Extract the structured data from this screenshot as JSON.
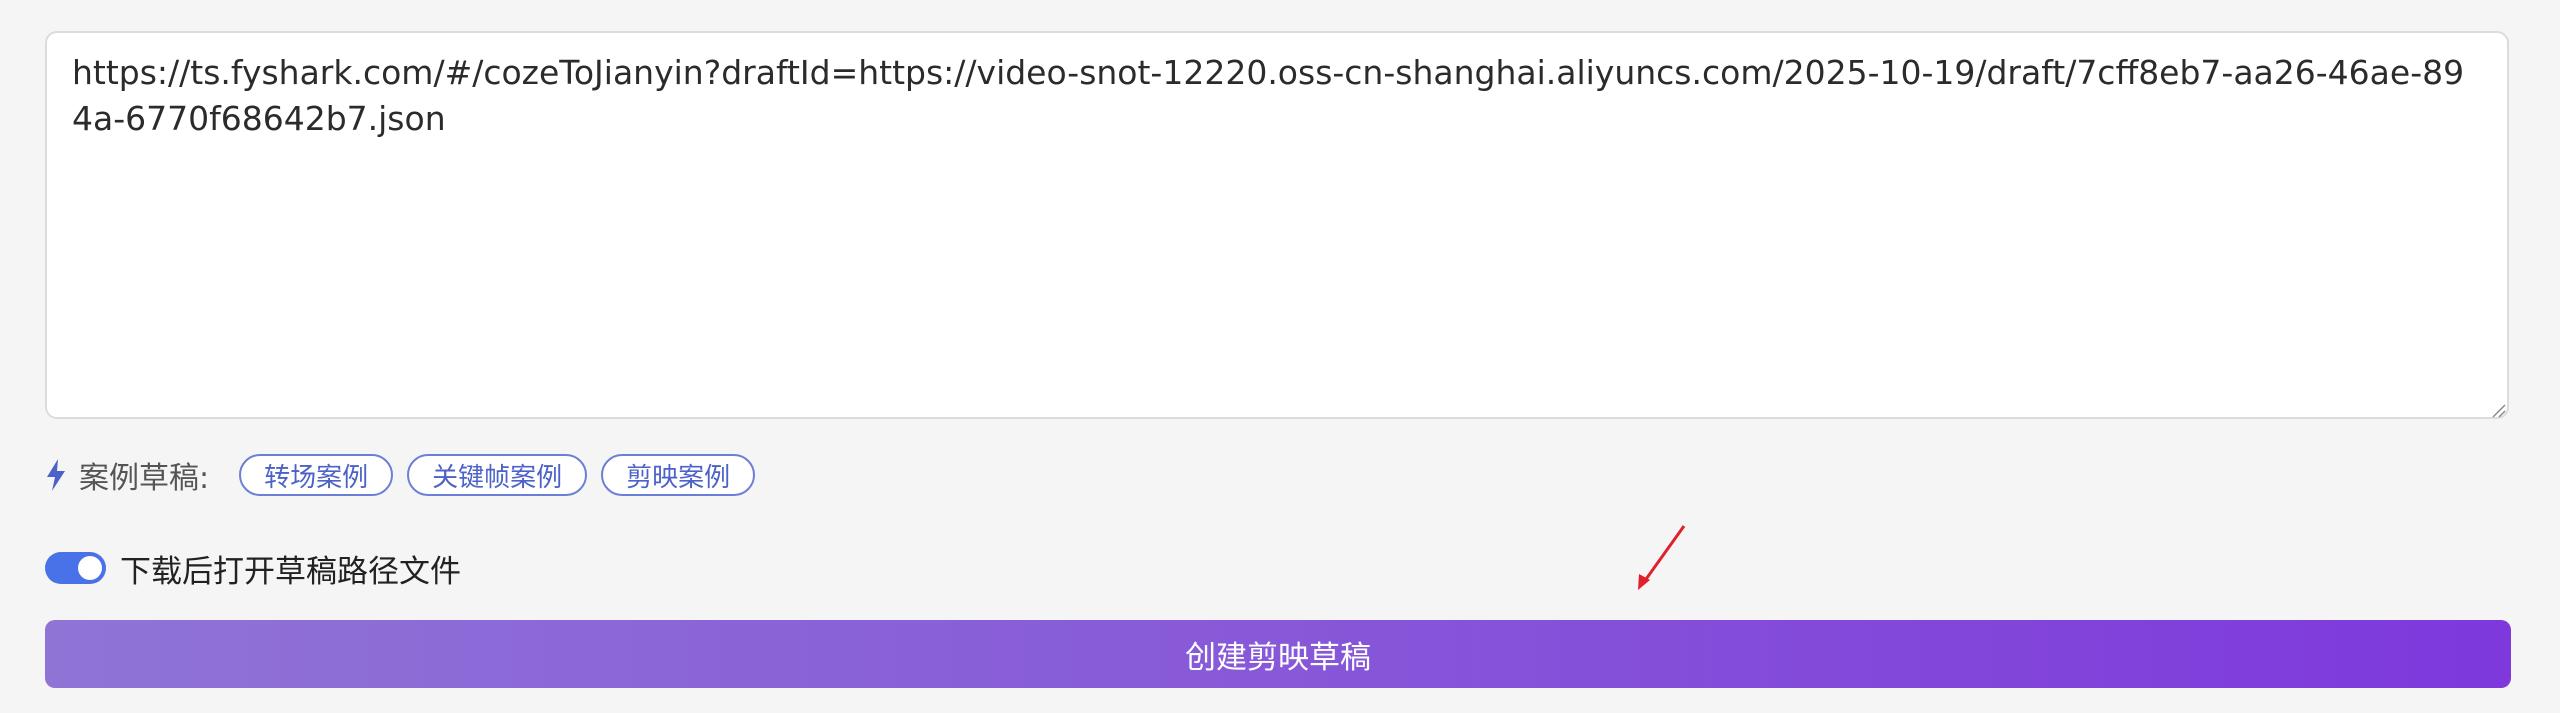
{
  "url_input": {
    "value": "https://ts.fyshark.com/#/cozeToJianyin?draftId=https://video-snot-12220.oss-cn-shanghai.aliyuncs.com/2025-10-19/draft/7cff8eb7-aa26-46ae-894a-6770f68642b7.json"
  },
  "examples": {
    "icon": "bolt-icon",
    "label": "案例草稿:",
    "chips": [
      {
        "label": "转场案例"
      },
      {
        "label": "关键帧案例"
      },
      {
        "label": "剪映案例"
      }
    ]
  },
  "toggle": {
    "checked": true,
    "label": "下载后打开草稿路径文件"
  },
  "annotation": {
    "icon": "red-arrow-icon",
    "color": "#e0202a"
  },
  "create_button": {
    "label": "创建剪映草稿"
  },
  "colors": {
    "accent": "#4a72e8",
    "chip_border": "#6b7fd6",
    "button_gradient_start": "#8f74d6",
    "button_gradient_end": "#7e38dc"
  }
}
